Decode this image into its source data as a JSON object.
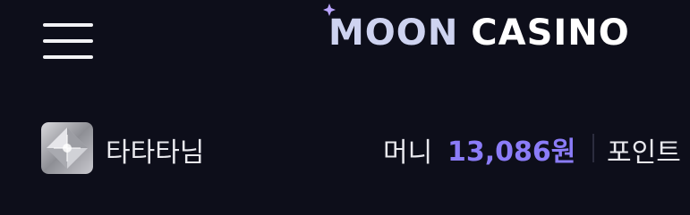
{
  "header": {
    "logo_moon_text": "MOON",
    "logo_casino_text": "CASINO",
    "menu_icon": "hamburger-menu-icon"
  },
  "user": {
    "name": "타타타님",
    "avatar_icon": "diamond-gem-icon"
  },
  "balance": {
    "money_label": "머니",
    "money_value": "13,086원",
    "points_label": "포인트"
  },
  "colors": {
    "background": "#0d0e1a",
    "accent": "#8b7cf8",
    "moon_purple": "#7b56e6",
    "text": "#e9e9ee"
  }
}
